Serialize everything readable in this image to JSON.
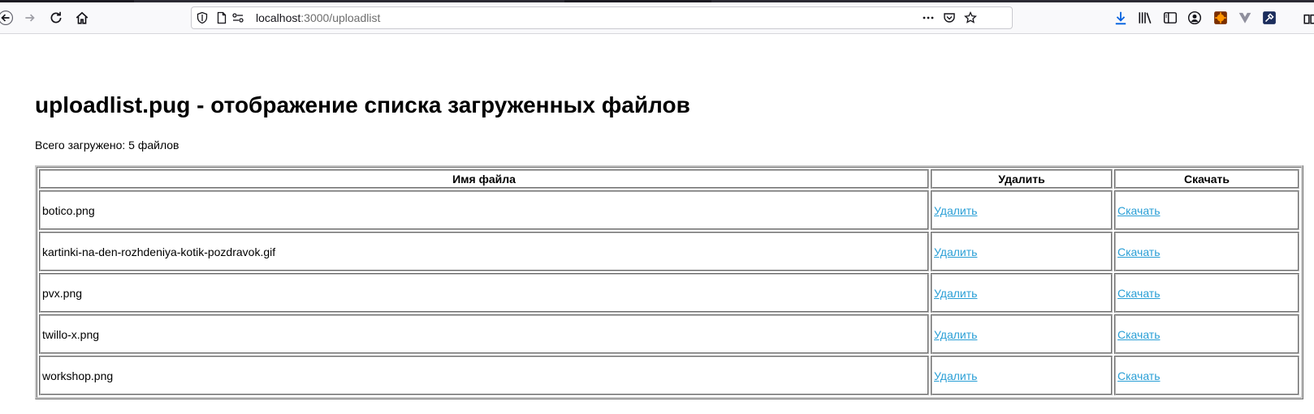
{
  "browser": {
    "url_host": "localhost",
    "url_path": ":3000/uploadlist"
  },
  "page": {
    "heading": "uploadlist.pug - отображение списка загруженных файлов",
    "summary": "Всего загружено: 5 файлов"
  },
  "table": {
    "headers": [
      "Имя файла",
      "Удалить",
      "Скачать"
    ],
    "rows": [
      {
        "name": "botico.png",
        "delete": "Удалить",
        "download": "Скачать"
      },
      {
        "name": "kartinki-na-den-rozhdeniya-kotik-pozdravok.gif",
        "delete": "Удалить",
        "download": "Скачать"
      },
      {
        "name": "pvx.png",
        "delete": "Удалить",
        "download": "Скачать"
      },
      {
        "name": "twillo-x.png",
        "delete": "Удалить",
        "download": "Скачать"
      },
      {
        "name": "workshop.png",
        "delete": "Удалить",
        "download": "Скачать"
      }
    ]
  },
  "colors": {
    "link": "#2a9fd6",
    "download_icon": "#0060df"
  }
}
